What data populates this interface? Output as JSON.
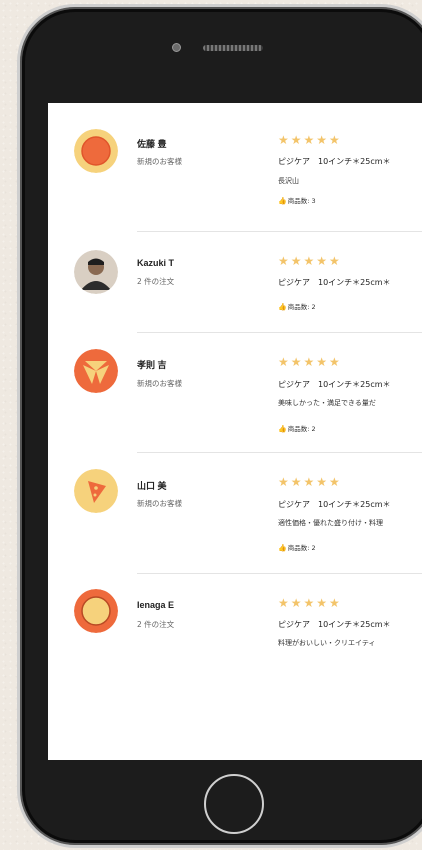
{
  "reviews": [
    {
      "name": "佐藤 豊",
      "subtitle": "新規のお客様",
      "stars": "★★★★★",
      "product": "ピジケア　10インチ＊25cm＊",
      "comment": "長沢山",
      "likes_label": "商品数: 3",
      "avatar_icon": "pizza-icon"
    },
    {
      "name": "Kazuki T",
      "subtitle": "2 件の注文",
      "stars": "★★★★★",
      "product": "ピジケア　10インチ＊25cm＊",
      "comment": "",
      "likes_label": "商品数: 2",
      "avatar_icon": "user-photo-avatar"
    },
    {
      "name": "孝則 吉",
      "subtitle": "新規のお客様",
      "stars": "★★★★★",
      "product": "ピジケア　10インチ＊25cm＊",
      "comment": "美味しかった・満足できる量だ",
      "likes_label": "商品数: 2",
      "avatar_icon": "pizza-slices-icon"
    },
    {
      "name": "山口 美",
      "subtitle": "新規のお客様",
      "stars": "★★★★★",
      "product": "ピジケア　10インチ＊25cm＊",
      "comment": "適性価格・優れた盛り付け・料理",
      "likes_label": "商品数: 2",
      "avatar_icon": "pizza-slice-icon"
    },
    {
      "name": "Ienaga E",
      "subtitle": "2 件の注文",
      "stars": "★★★★★",
      "product": "ピジケア　10インチ＊25cm＊",
      "comment": "料理がおいしい・クリエイティ",
      "likes_label": "",
      "avatar_icon": "ring-pizza-icon"
    }
  ],
  "colors": {
    "star": "#f3c46a",
    "avatar_yellow": "#f6d27c",
    "avatar_orange": "#ee6a3c"
  }
}
